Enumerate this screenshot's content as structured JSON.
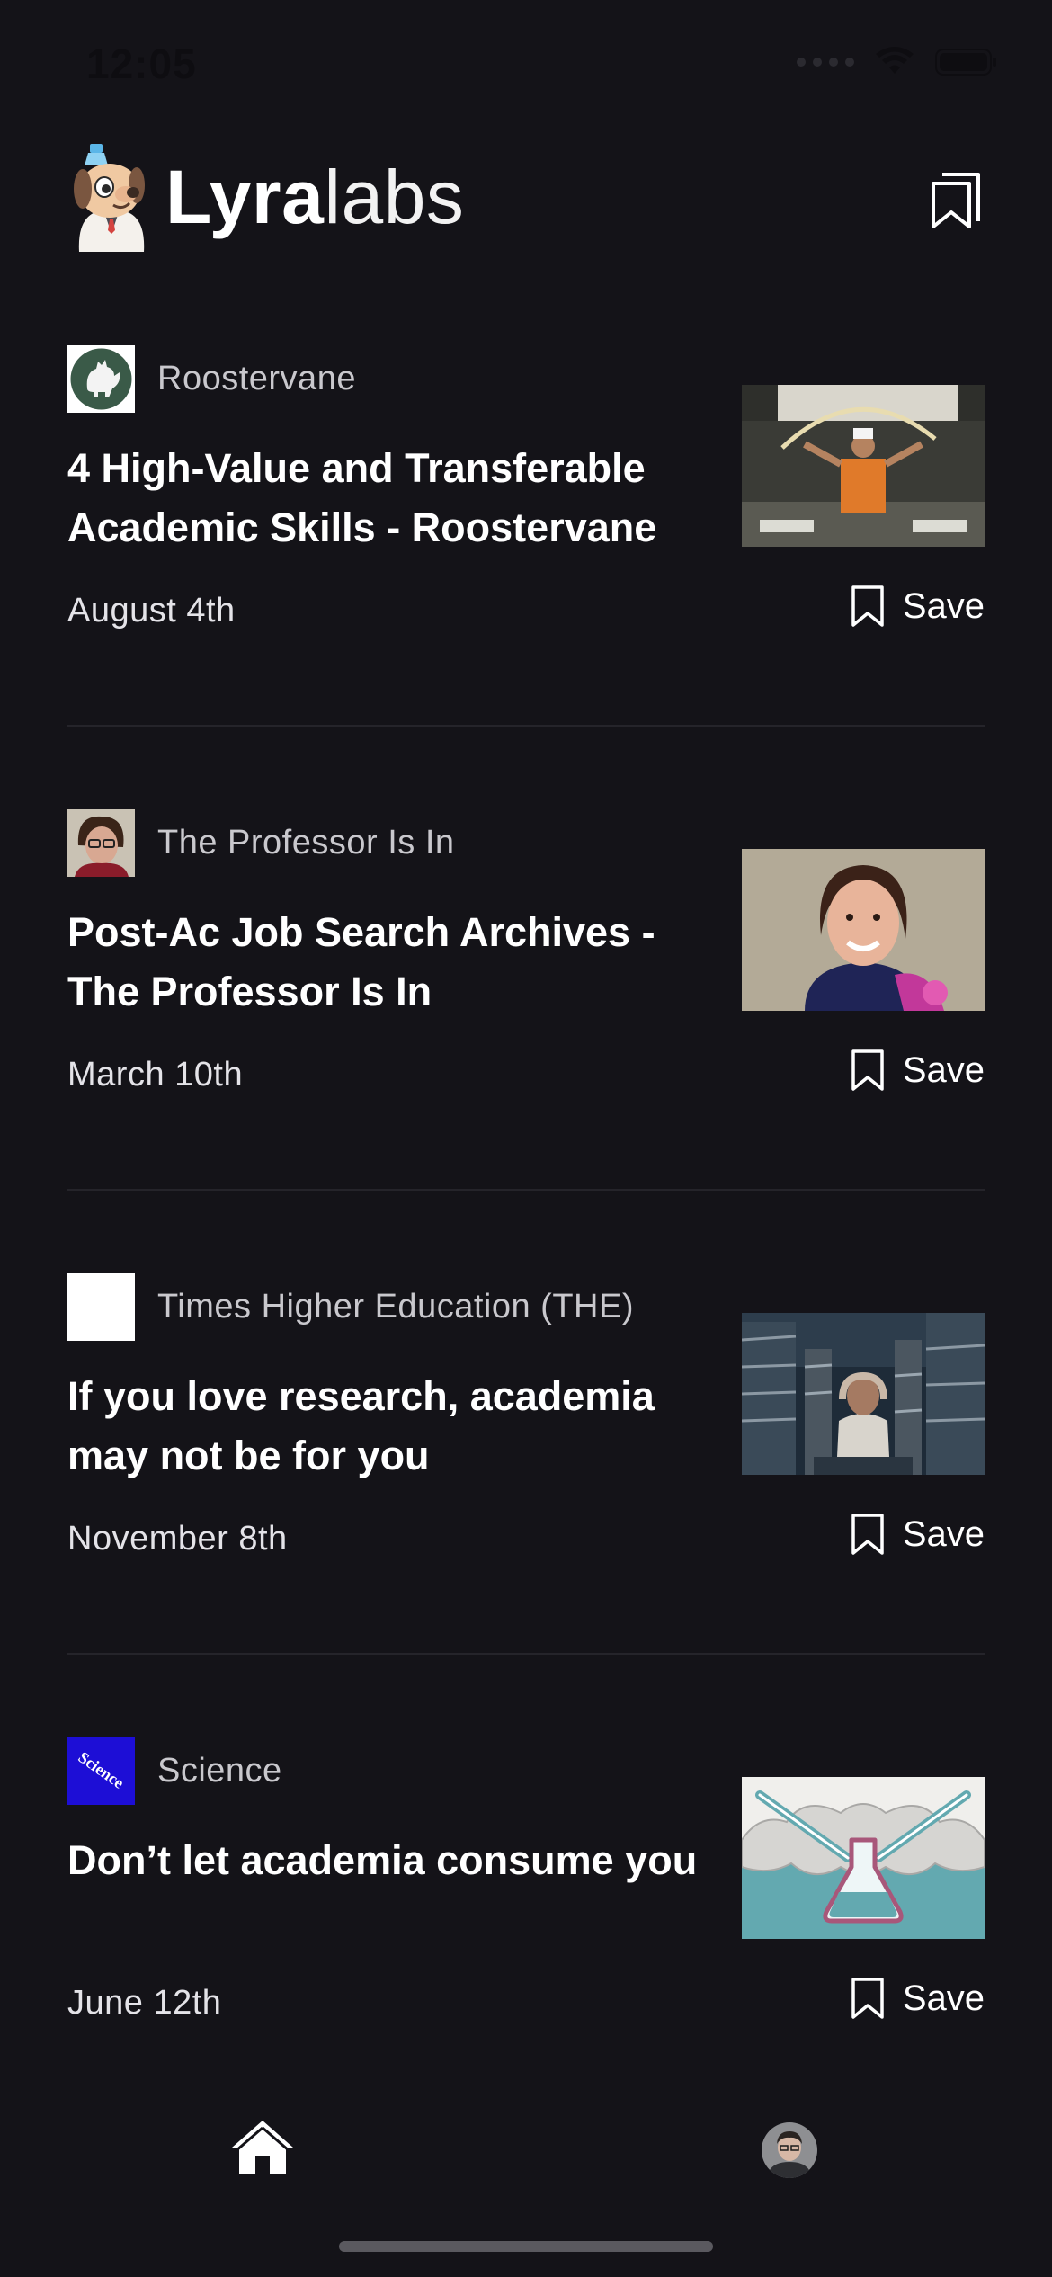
{
  "status_bar": {
    "time": "12:05"
  },
  "header": {
    "logo_bold": "Lyra",
    "logo_light": "labs",
    "saved_icon": "bookmarks-icon"
  },
  "articles": [
    {
      "source": "Roostervane",
      "source_icon": "rooster-logo-icon",
      "title": "4 High-Value and Transferable Academic Skills - Roostervane",
      "date": "August 4th",
      "save_label": "Save",
      "thumb": "chef-pulling-noodles"
    },
    {
      "source": "The Professor Is In",
      "source_icon": "professor-avatar-icon",
      "title": "Post-Ac Job Search Archives - The Professor Is In",
      "date": "March 10th",
      "save_label": "Save",
      "thumb": "smiling-woman-portrait"
    },
    {
      "source": "Times Higher Education (THE)",
      "source_icon": "the-logo-icon",
      "title": "If you love research, academia may not be for you",
      "date": "November 8th",
      "save_label": "Save",
      "thumb": "person-among-paper-stacks"
    },
    {
      "source": "Science",
      "source_icon": "science-logo-icon",
      "source_logo_text": "Science",
      "title": "Don’t let academia consume you",
      "date": "June 12th",
      "save_label": "Save",
      "thumb": "flask-illustration"
    }
  ],
  "bottom_nav": {
    "home_icon": "home-icon",
    "profile_icon": "profile-avatar-icon"
  },
  "colors": {
    "background": "#141318",
    "divider": "#25242a",
    "text_primary": "#ffffff",
    "text_secondary": "#c9c8cd",
    "science_blue": "#1d0ed6",
    "illustration_teal": "#63a9b0"
  }
}
